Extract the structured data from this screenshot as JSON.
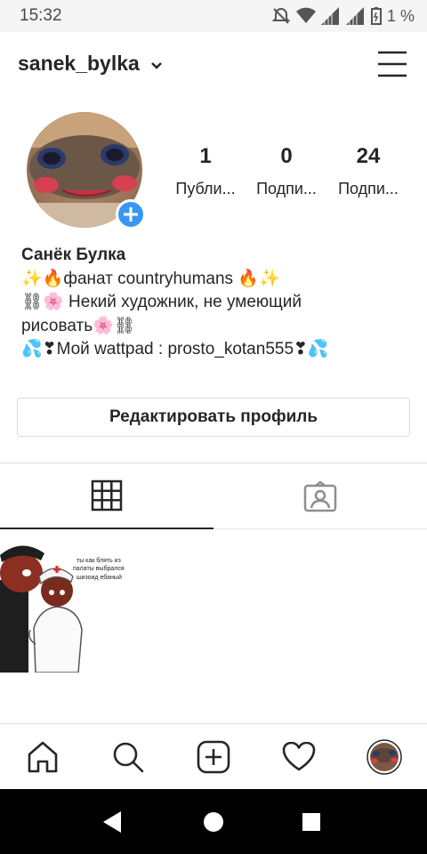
{
  "status_bar": {
    "time": "15:32",
    "battery": "1 %"
  },
  "header": {
    "username": "sanek_bylka"
  },
  "profile": {
    "stats": [
      {
        "count": "1",
        "label": "Публи..."
      },
      {
        "count": "0",
        "label": "Подпи..."
      },
      {
        "count": "24",
        "label": "Подпи..."
      }
    ],
    "bio": {
      "name": "Санёк Булка",
      "lines": [
        "✨🔥фанат countryhumans 🔥✨",
        "⛓🌸 Некий художник, не умеющий",
        "рисовать🌸⛓",
        "💦❣Мой wattpad : prosto_kotan555❣💦"
      ]
    },
    "edit_button_label": "Редактировать профиль"
  },
  "tabs": [
    {
      "icon": "grid-icon",
      "active": true
    },
    {
      "icon": "tagged-person-icon",
      "active": false
    }
  ],
  "post": {
    "caption_lines": [
      "ты как блять из",
      "палаты выбрался",
      "шизоид ебаный"
    ]
  },
  "bottom_nav": [
    "home-icon",
    "search-icon",
    "add-post-icon",
    "heart-icon",
    "profile-avatar"
  ],
  "colors": {
    "accent_blue": "#3897f0",
    "border": "#dbdbdb",
    "text": "#262626"
  }
}
